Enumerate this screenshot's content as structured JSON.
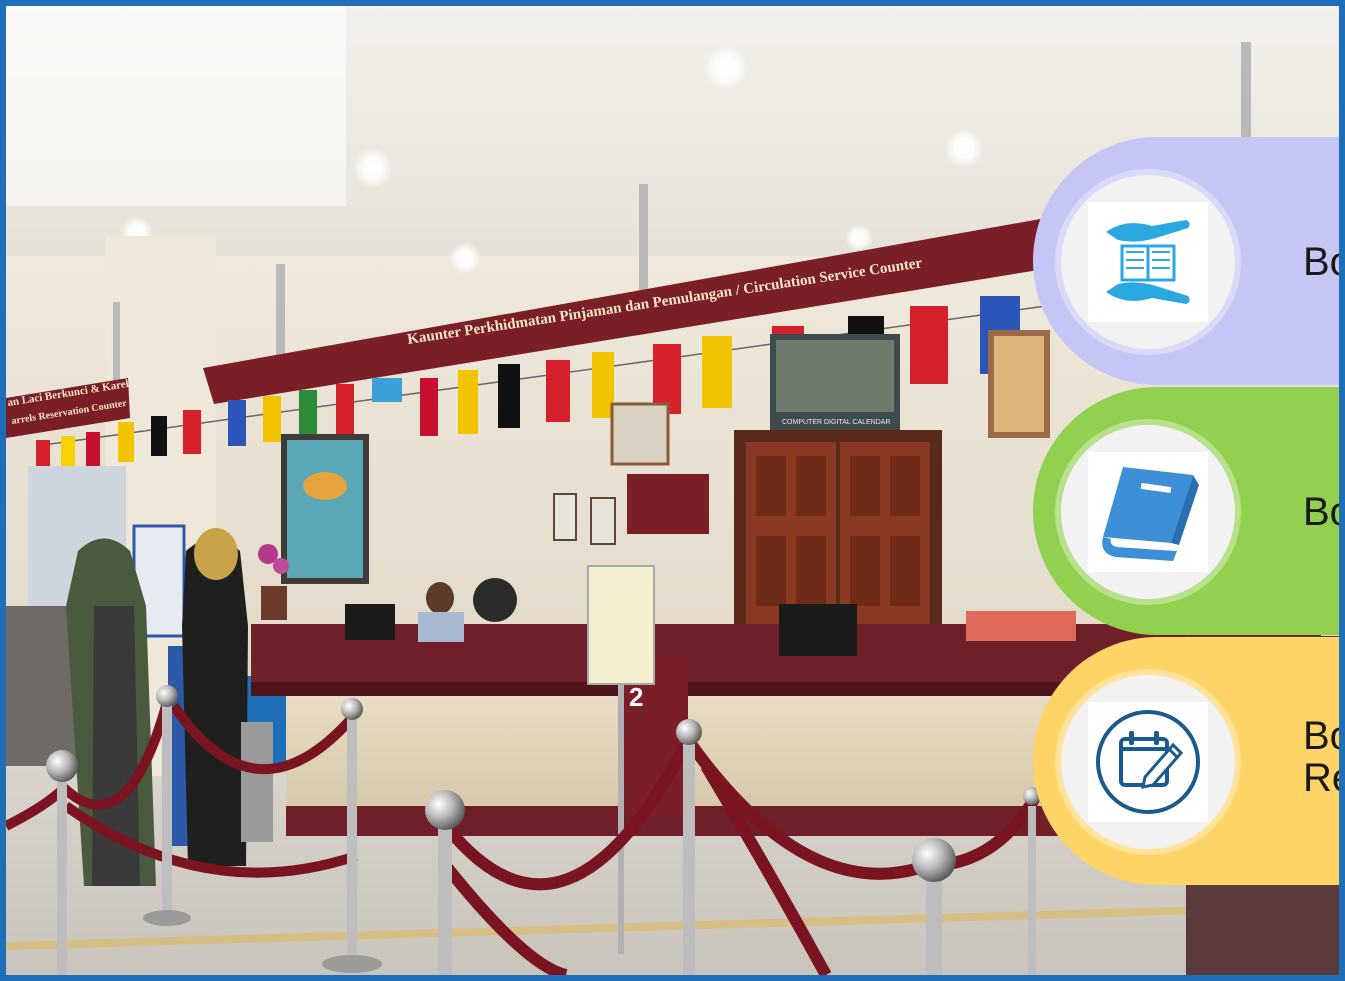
{
  "scene": {
    "banner_main": "Kaunter Perkhidmatan Pinjaman dan Pemulangan / Circulation Service Counter",
    "banner_side_line1": "an Laci Berkunci & Karel",
    "banner_side_line2": "arrels Reservation Counter",
    "counter_number": "2",
    "calendar_label": "COMPUTER DIGITAL CALENDAR"
  },
  "cards": [
    {
      "label": "Bo",
      "bg": "#c5c6f5",
      "icon": "hands-book-icon"
    },
    {
      "label": "Bo",
      "bg": "#92d050",
      "icon": "book-icon"
    },
    {
      "label_line1": "Bo",
      "label_line2": "Re",
      "bg": "#ffd467",
      "icon": "calendar-edit-icon"
    }
  ],
  "colors": {
    "frame": "#1f6fb8",
    "banner": "#7a1e27",
    "icon_blue": "#2aa8e0",
    "icon_navy": "#1b5a8f"
  }
}
